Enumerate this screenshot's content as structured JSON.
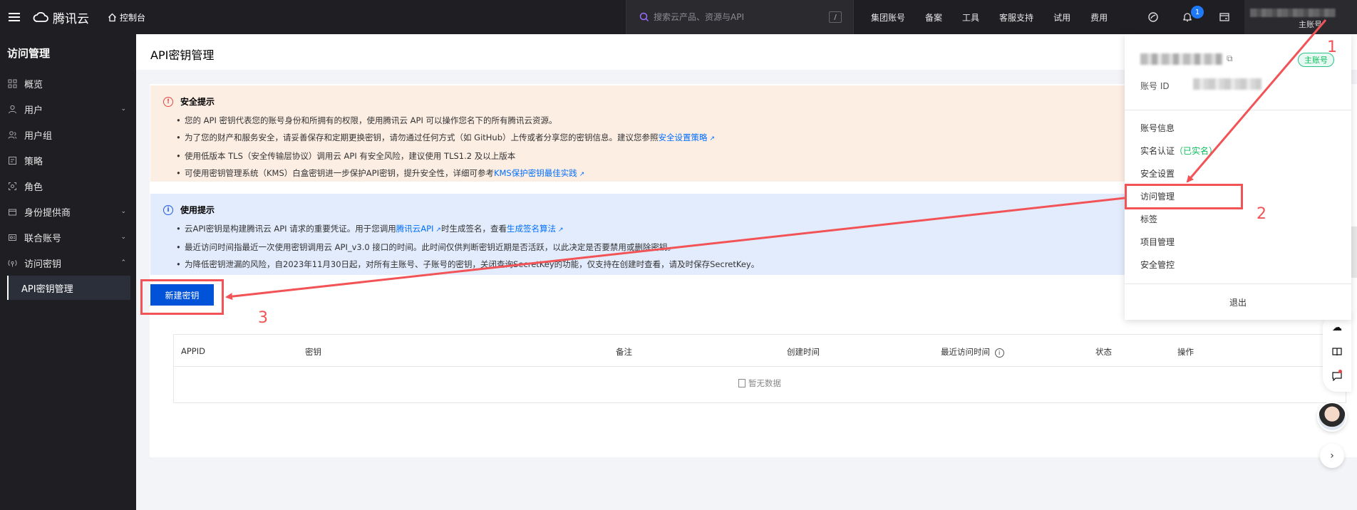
{
  "topbar": {
    "brand": "腾讯云",
    "console": "控制台",
    "search_placeholder": "搜索云产品、资源与API",
    "search_shortcut": "/",
    "nav": [
      "集团账号",
      "备案",
      "工具",
      "客服支持",
      "试用",
      "费用"
    ],
    "notification_count": "1",
    "account_label": "主账号"
  },
  "sidebar": {
    "title": "访问管理",
    "items": [
      {
        "label": "概览",
        "icon": "grid-icon"
      },
      {
        "label": "用户",
        "icon": "user-icon",
        "chevron": "down"
      },
      {
        "label": "用户组",
        "icon": "users-icon"
      },
      {
        "label": "策略",
        "icon": "policy-icon"
      },
      {
        "label": "角色",
        "icon": "role-icon"
      },
      {
        "label": "身份提供商",
        "icon": "idp-icon",
        "chevron": "down"
      },
      {
        "label": "联合账号",
        "icon": "federated-icon",
        "chevron": "down"
      },
      {
        "label": "访问密钥",
        "icon": "key-icon",
        "chevron": "up"
      }
    ],
    "active_sub": "API密钥管理"
  },
  "page": {
    "title": "API密钥管理",
    "security_tip": {
      "title": "安全提示",
      "lines": [
        {
          "text": "您的 API 密钥代表您的账号身份和所拥有的权限，使用腾讯云 API 可以操作您名下的所有腾讯云资源。"
        },
        {
          "text": "为了您的财产和服务安全，请妥善保存和定期更换密钥，请勿通过任何方式（如 GitHub）上传或者分享您的密钥信息。建议您参照",
          "link": "安全设置策略"
        },
        {
          "text": "使用低版本 TLS（安全传输层协议）调用云 API 有安全风险，建议使用 TLS1.2 及以上版本"
        },
        {
          "text": "可使用密钥管理系统（KMS）白盒密钥进一步保护API密钥，提升安全性，详细可参考",
          "link": "KMS保护密钥最佳实践"
        }
      ]
    },
    "usage_tip": {
      "title": "使用提示",
      "line1_a": "云API密钥是构建腾讯云 API 请求的重要凭证。用于您调用",
      "line1_link1": "腾讯云API",
      "line1_b": "时生成签名，查看",
      "line1_link2": "生成签名算法",
      "line2": "最近访问时间指最近一次使用密钥调用云 API_v3.0 接口的时间。此时间仅供判断密钥近期是否活跃，以此决定是否要禁用或删除密钥。",
      "line3": "为降低密钥泄漏的风险，自2023年11月30日起，对所有主账号、子账号的密钥，关闭查询SecretKey的功能，仅支持在创建时查看，请及时保存SecretKey。"
    },
    "new_key_button": "新建密钥",
    "table": {
      "headers": [
        "APPID",
        "密钥",
        "备注",
        "创建时间",
        "最近访问时间",
        "状态",
        "操作"
      ],
      "empty_text": "暂无数据"
    }
  },
  "dropdown": {
    "badge": "主账号",
    "account_id_label": "账号 ID",
    "items": [
      "账号信息",
      "实名认证",
      "安全设置",
      "访问管理",
      "标签",
      "项目管理",
      "安全管控"
    ],
    "verified_suffix": "（已实名）",
    "logout": "退出"
  },
  "annotations": {
    "step1": "1",
    "step2": "2",
    "step3": "3",
    "color": "#f25356"
  }
}
